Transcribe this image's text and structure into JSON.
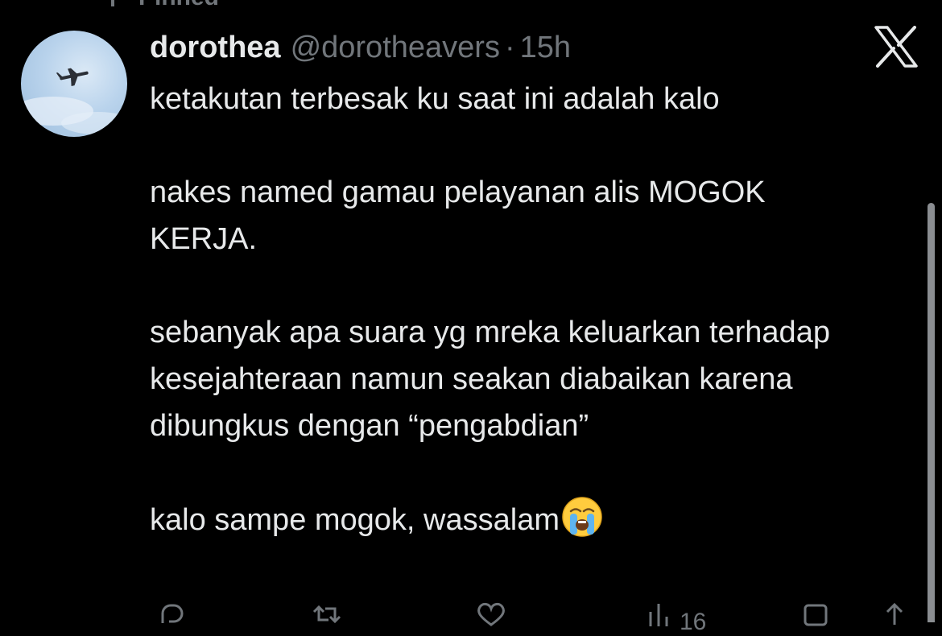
{
  "pinned": {
    "label": "Pinned"
  },
  "tweet": {
    "display_name": "dorothea",
    "handle": "@dorotheavers",
    "separator": "·",
    "time": "15h",
    "paragraphs": [
      "ketakutan terbesak ku saat ini adalah kalo",
      "nakes named gamau pelayanan alis MOGOK KERJA.",
      "sebanyak apa suara yg mreka keluarkan terhadap kesejahteraan namun seakan diabaikan karena dibungkus dengan “pengabdian”",
      "kalo sampe mogok, wassalam"
    ],
    "trailing_emoji": "loudly-crying-face"
  },
  "actions": {
    "views_count": "16"
  },
  "icons": {
    "logo": "x-logo-icon",
    "reply": "reply-icon",
    "retweet": "retweet-icon",
    "like": "like-icon",
    "views": "views-icon",
    "bookmark": "bookmark-icon",
    "share": "share-icon"
  },
  "colors": {
    "background": "#000000",
    "text": "#e7e9ea",
    "muted": "#71767b"
  }
}
